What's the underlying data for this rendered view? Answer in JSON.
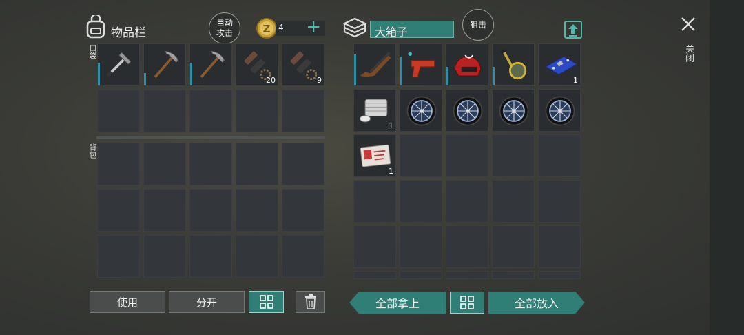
{
  "inventory": {
    "title": "物品栏",
    "auto_attack_line1": "自动",
    "auto_attack_line2": "攻击",
    "coins": "4",
    "pocket_label": "口袋",
    "backpack_label": "背包",
    "pocket_slots": [
      {
        "icon": "hammer-icon",
        "count": "",
        "durability": 0.55
      },
      {
        "icon": "pickaxe-icon",
        "count": "",
        "durability": 0.3
      },
      {
        "icon": "pickaxe-icon",
        "count": "",
        "durability": 0.55
      },
      {
        "icon": "bolt-parts-icon",
        "count": "20",
        "durability": 0
      },
      {
        "icon": "bolt-parts-icon",
        "count": "9",
        "durability": 0
      }
    ]
  },
  "container": {
    "title": "大箱子",
    "snipe_label": "狙击",
    "slots": [
      {
        "icon": "shotgun-icon",
        "count": "",
        "durability": 0.75
      },
      {
        "icon": "flare-gun-icon",
        "count": "",
        "durability": 0.7
      },
      {
        "icon": "helmet-icon",
        "count": "",
        "durability": 0.45
      },
      {
        "icon": "magnifier-icon",
        "count": "",
        "durability": 0.45
      },
      {
        "icon": "circuit-board-icon",
        "count": "1",
        "durability": 0
      },
      {
        "icon": "engine-block-icon",
        "count": "1",
        "durability": 0
      },
      {
        "icon": "wheel-icon",
        "count": "",
        "durability": 0
      },
      {
        "icon": "wheel-icon",
        "count": "",
        "durability": 0
      },
      {
        "icon": "wheel-icon",
        "count": "",
        "durability": 0
      },
      {
        "icon": "wheel-icon",
        "count": "",
        "durability": 0
      },
      {
        "icon": "id-card-icon",
        "count": "1",
        "durability": 0
      }
    ]
  },
  "buttons": {
    "use": "使用",
    "split": "分开",
    "take_all": "全部拿上",
    "put_all": "全部放入"
  },
  "close_label": "关闭",
  "colors": {
    "accent": "#2f7f76",
    "durability": "#2e8fa8",
    "slot": "#33363a"
  }
}
